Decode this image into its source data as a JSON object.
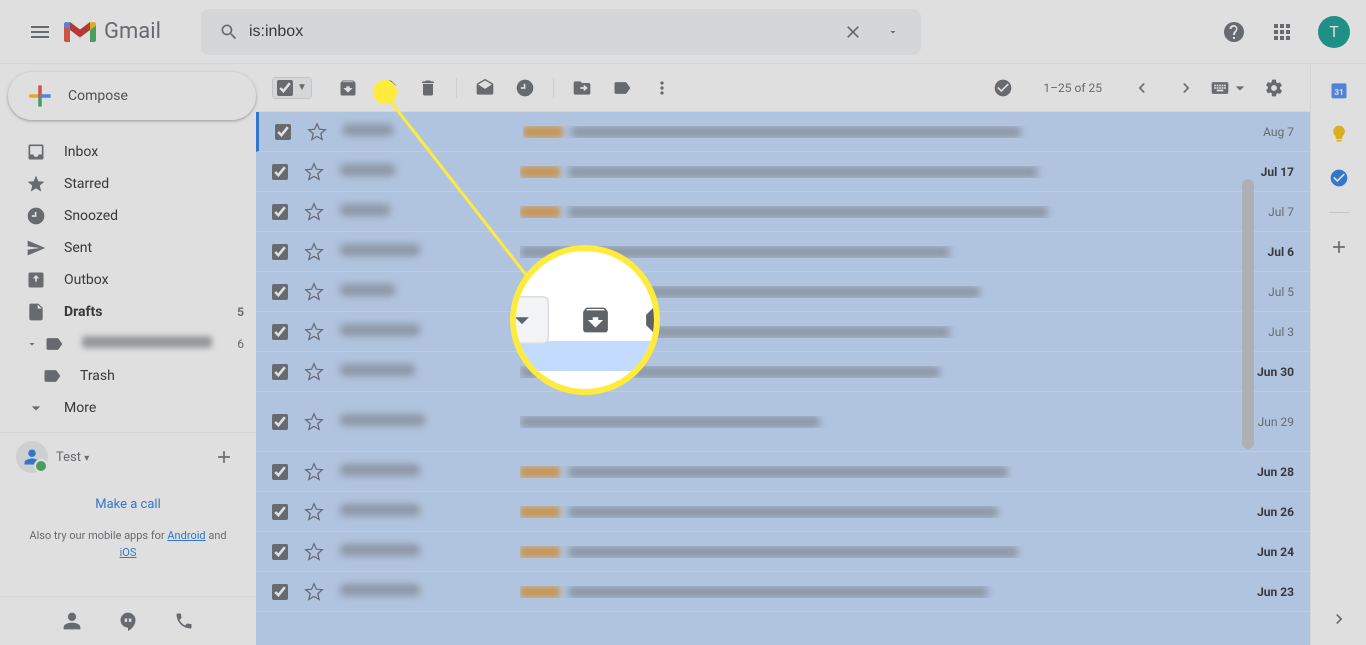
{
  "header": {
    "logo_text": "Gmail",
    "search_value": "is:inbox",
    "avatar_letter": "T"
  },
  "compose_label": "Compose",
  "sidebar": {
    "items": [
      {
        "label": "Inbox",
        "count": ""
      },
      {
        "label": "Starred",
        "count": ""
      },
      {
        "label": "Snoozed",
        "count": ""
      },
      {
        "label": "Sent",
        "count": ""
      },
      {
        "label": "Outbox",
        "count": ""
      },
      {
        "label": "Drafts",
        "count": "5",
        "bold": true
      },
      {
        "label": "",
        "count": "6",
        "blurred": true
      },
      {
        "label": "Trash",
        "count": "",
        "sub": true
      },
      {
        "label": "More",
        "count": ""
      }
    ]
  },
  "hangouts": {
    "name": "Test",
    "caret": "▾"
  },
  "make_call": "Make a call",
  "mobile_prompt_prefix": "Also try our mobile apps for ",
  "mobile_prompt_android": "Android",
  "mobile_prompt_and": " and ",
  "mobile_prompt_ios": "iOS",
  "toolbar": {
    "count": "1–25 of 25"
  },
  "emails": [
    {
      "date": "Aug 7",
      "bold": false,
      "sw": 50,
      "lw": 40,
      "cw": 450
    },
    {
      "date": "Jul 17",
      "bold": true,
      "sw": 55,
      "lw": 40,
      "cw": 470
    },
    {
      "date": "Jul 7",
      "bold": false,
      "sw": 50,
      "lw": 40,
      "cw": 480
    },
    {
      "date": "Jul 6",
      "bold": true,
      "sw": 80,
      "lw": 0,
      "cw": 430
    },
    {
      "date": "Jul 5",
      "bold": false,
      "sw": 55,
      "lw": 0,
      "cw": 460
    },
    {
      "date": "Jul 3",
      "bold": false,
      "sw": 80,
      "lw": 0,
      "cw": 430
    },
    {
      "date": "Jun 30",
      "bold": true,
      "sw": 75,
      "lw": 0,
      "cw": 420
    },
    {
      "date": "Jun 29",
      "bold": false,
      "sw": 85,
      "lw": 0,
      "cw": 300,
      "tall": true
    },
    {
      "date": "Jun 28",
      "bold": true,
      "sw": 80,
      "lw": 40,
      "cw": 440
    },
    {
      "date": "Jun 26",
      "bold": true,
      "sw": 80,
      "lw": 40,
      "cw": 430
    },
    {
      "date": "Jun 24",
      "bold": true,
      "sw": 80,
      "lw": 40,
      "cw": 450
    },
    {
      "date": "Jun 23",
      "bold": true,
      "sw": 80,
      "lw": 40,
      "cw": 420
    }
  ]
}
